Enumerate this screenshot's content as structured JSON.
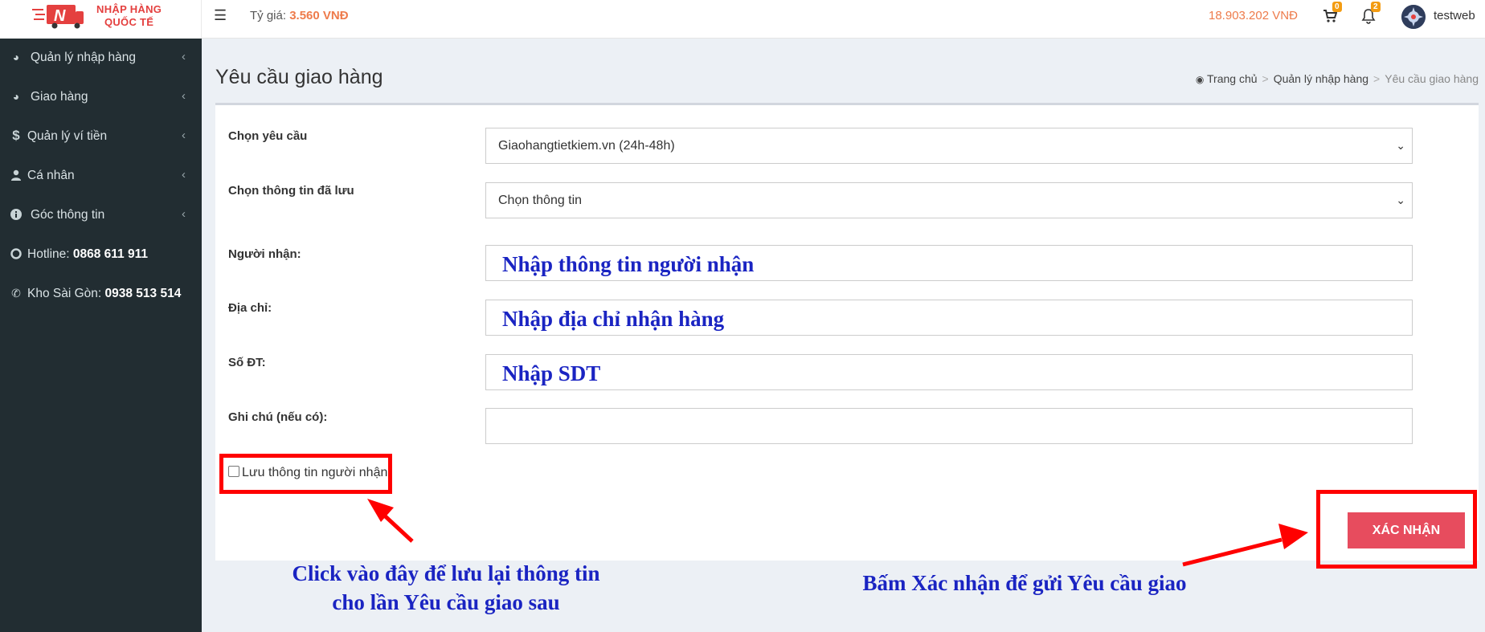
{
  "header": {
    "logo_line1": "NHẬP HÀNG",
    "logo_line2": "QUỐC TẾ",
    "rate_label": "Tỷ giá:",
    "rate_value": "3.560 VNĐ",
    "balance": "18.903.202 VNĐ",
    "cart_count": "0",
    "notif_count": "2",
    "username": "testweb"
  },
  "sidebar": {
    "items": [
      {
        "label": "Quản lý nhập hàng",
        "icon": "pie-chart-icon"
      },
      {
        "label": "Giao hàng",
        "icon": "pie-chart-icon"
      },
      {
        "label": "Quản lý ví tiền",
        "icon": "dollar-icon"
      },
      {
        "label": "Cá nhân",
        "icon": "user-icon"
      },
      {
        "label": "Góc thông tin",
        "icon": "info-icon"
      }
    ],
    "hotline_label": "Hotline:",
    "hotline_value": "0868 611 911",
    "warehouse_label": "Kho Sài Gòn:",
    "warehouse_value": "0938 513 514"
  },
  "page": {
    "title": "Yêu cầu giao hàng",
    "breadcrumb": [
      "Trang chủ",
      "Quản lý nhập hàng",
      "Yêu cầu giao hàng"
    ]
  },
  "form": {
    "request_label": "Chọn yêu cầu",
    "request_value": "Giaohangtietkiem.vn (24h-48h)",
    "saved_label": "Chọn thông tin đã lưu",
    "saved_value": "Chọn thông tin",
    "receiver_label": "Người nhận:",
    "address_label": "Địa chỉ:",
    "phone_label": "Số ĐT:",
    "note_label": "Ghi chú (nếu có):",
    "note_value": "",
    "save_checkbox_label": "Lưu thông tin người nhận",
    "save_checkbox_checked": false,
    "submit_label": "XÁC NHẬN"
  },
  "annotations": {
    "receiver_hint": "Nhập thông tin người nhận",
    "address_hint": "Nhập địa chỉ nhận hàng",
    "phone_hint": "Nhập SDT",
    "checkbox_note_line1": "Click vào đây để lưu lại thông tin",
    "checkbox_note_line2": "cho lần Yêu cầu giao sau",
    "submit_note": "Bấm Xác nhận để gửi Yêu cầu giao"
  },
  "colors": {
    "sidebar_bg": "#222d32",
    "accent_orange": "#ee7b4b",
    "submit_red": "#e74c5e",
    "annotation_blue": "#1a24c2",
    "annotation_red": "#ff0000"
  }
}
